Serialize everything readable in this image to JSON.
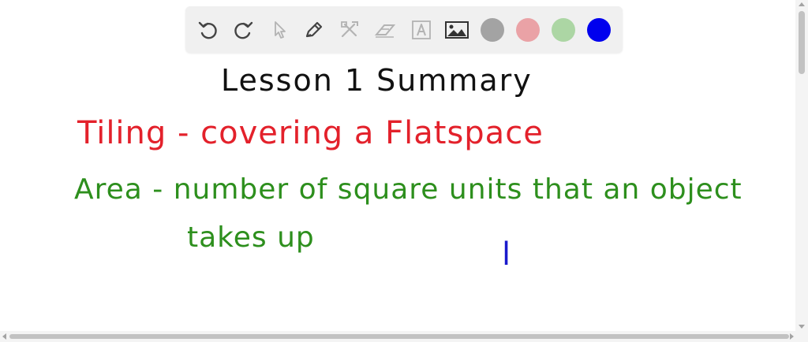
{
  "toolbar": {
    "tools": [
      "undo-icon",
      "redo-icon",
      "pointer-icon",
      "pen-icon",
      "tools-icon",
      "eraser-icon",
      "text-icon",
      "image-icon"
    ],
    "colors": {
      "gray": "#a3a3a3",
      "red": "#eaa2a6",
      "green": "#acd6a4",
      "blue": "#0000ee"
    },
    "selected_color": "blue"
  },
  "canvas": {
    "title": "Lesson 1 Summary",
    "tiling_text": "Tiling - covering a Flatspace",
    "area_line1": "Area - number of square units that an object",
    "area_line2": "takes up",
    "blue_mark": "l",
    "ink_colors": {
      "title": "#111111",
      "tiling": "#e3212b",
      "area": "#2d8f1d",
      "mark": "#1a1acc"
    }
  }
}
